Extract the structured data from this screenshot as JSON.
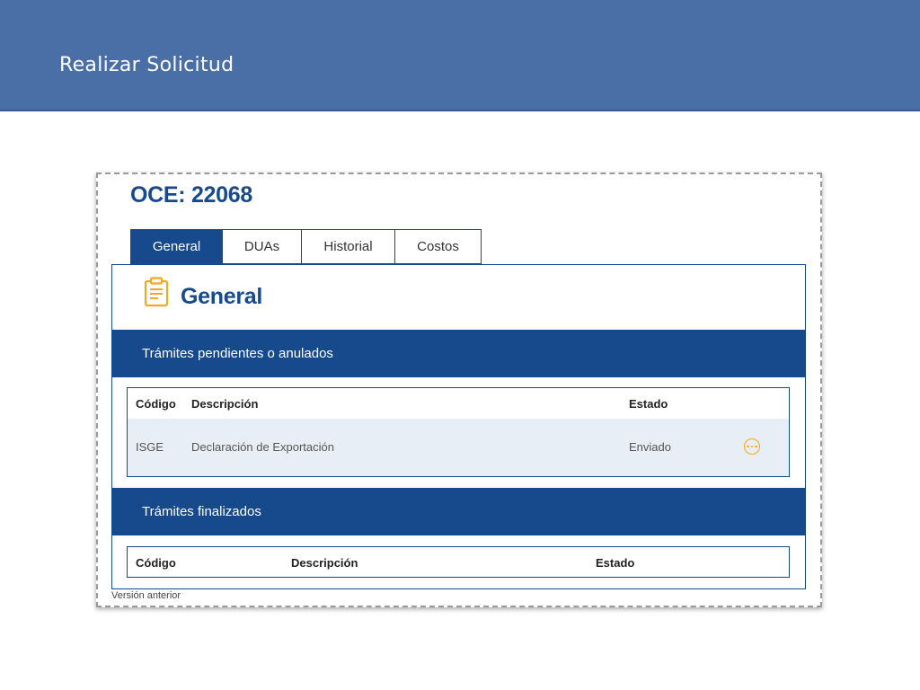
{
  "header": {
    "title": "Realizar Solicitud"
  },
  "oce": {
    "title": "OCE: 22068"
  },
  "tabs": [
    {
      "label": "General",
      "active": true
    },
    {
      "label": "DUAs",
      "active": false
    },
    {
      "label": "Historial",
      "active": false
    },
    {
      "label": "Costos",
      "active": false
    }
  ],
  "section": {
    "title": "General",
    "icon": "clipboard-icon"
  },
  "pending": {
    "title": "Trámites pendientes o anulados",
    "columns": [
      "Código",
      "Descripción",
      "Estado"
    ],
    "rows": [
      {
        "codigo": "ISGE",
        "descripcion": "Declaración de Exportación",
        "estado": "Enviado",
        "action_icon": "more-options-icon"
      }
    ]
  },
  "finished": {
    "title": "Trámites finalizados",
    "columns": [
      "Código",
      "Descripción",
      "Estado"
    ],
    "rows": []
  },
  "footer": {
    "link": "Versión anterior"
  },
  "colors": {
    "banner": "#4a6fa6",
    "primary": "#174a8c",
    "accent": "#f5a623",
    "row_highlight": "#e8eef6"
  }
}
